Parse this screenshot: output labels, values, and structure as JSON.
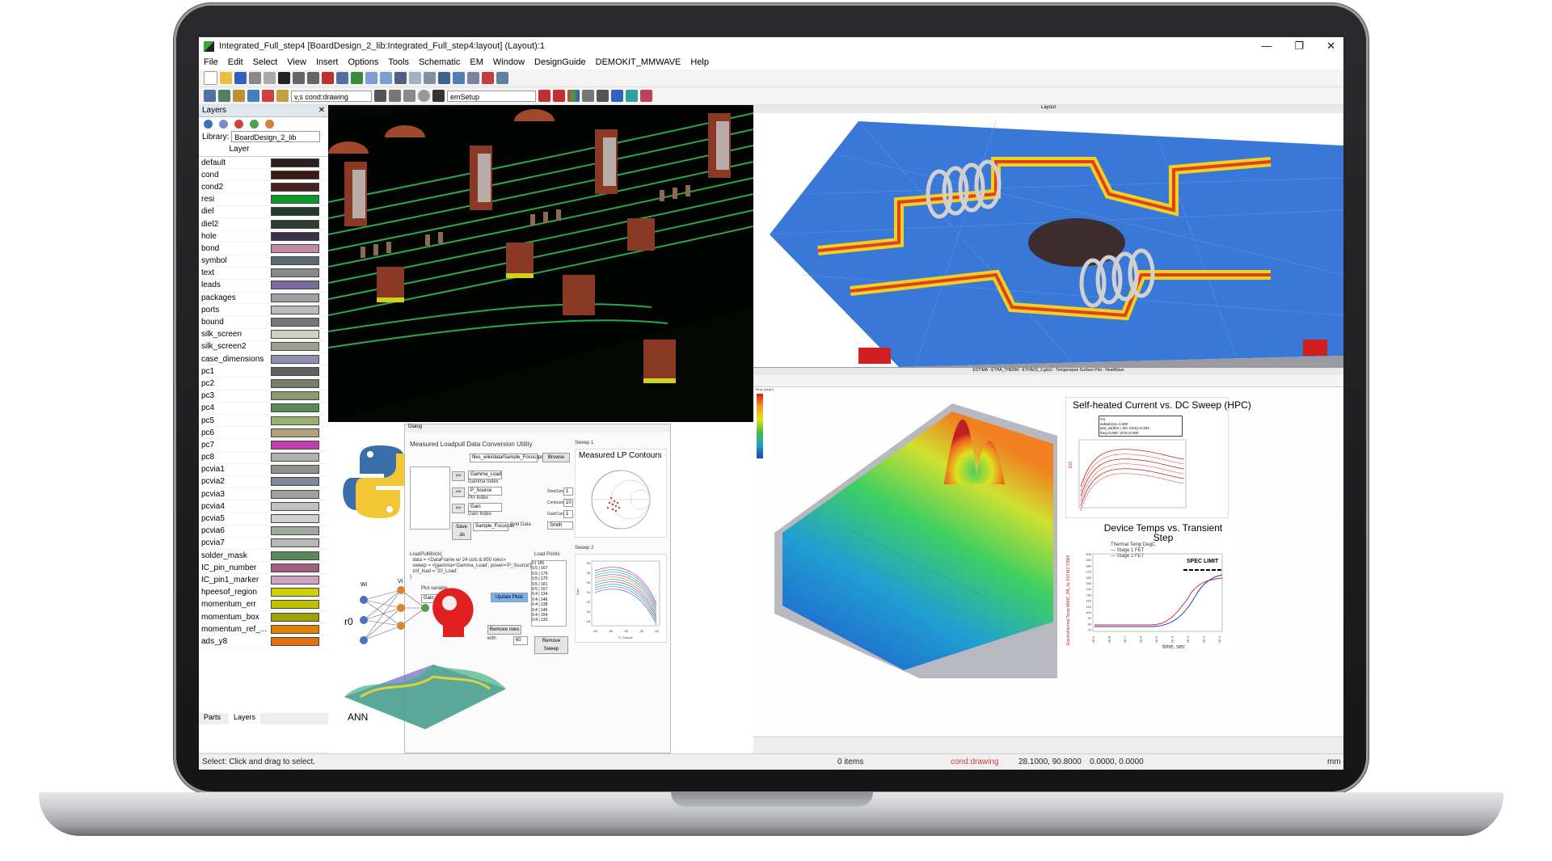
{
  "window": {
    "title": "Integrated_Full_step4 [BoardDesign_2_lib:Integrated_Full_step4:layout] (Layout):1",
    "controls": [
      "—",
      "❐",
      "✕"
    ]
  },
  "menu": [
    "File",
    "Edit",
    "Select",
    "View",
    "Insert",
    "Options",
    "Tools",
    "Schematic",
    "EM",
    "Window",
    "DesignGuide",
    "DEMOKIT_MMWAVE",
    "Help"
  ],
  "toolbar": {
    "layer_select": "v,s cond:drawing",
    "setup_select": "emSetup"
  },
  "layers_panel": {
    "title": "Layers",
    "library_label": "Library:",
    "library_value": "BoardDesign_2_lib",
    "column_header": "Layer",
    "tabs": [
      "Parts",
      "Layers"
    ],
    "items": [
      {
        "name": "default",
        "color": "#2a2020"
      },
      {
        "name": "cond",
        "color": "#3a1a12"
      },
      {
        "name": "cond2",
        "color": "#4a1f1f"
      },
      {
        "name": "resi",
        "color": "#0a9a2a"
      },
      {
        "name": "diel",
        "color": "#1f3a2a"
      },
      {
        "name": "diel2",
        "color": "#2a3d30"
      },
      {
        "name": "hole",
        "color": "#3a2f48"
      },
      {
        "name": "bond",
        "color": "#c08aa0"
      },
      {
        "name": "symbol",
        "color": "#5a6a70"
      },
      {
        "name": "text",
        "color": "#8a8a8a"
      },
      {
        "name": "leads",
        "color": "#7a6a9a"
      },
      {
        "name": "packages",
        "color": "#a0a0a0"
      },
      {
        "name": "ports",
        "color": "#bcbcbc"
      },
      {
        "name": "bound",
        "color": "#777777"
      },
      {
        "name": "silk_screen",
        "color": "#d0d0c0"
      },
      {
        "name": "silk_screen2",
        "color": "#a0a090"
      },
      {
        "name": "case_dimensions",
        "color": "#9090b0"
      },
      {
        "name": "pc1",
        "color": "#606060"
      },
      {
        "name": "pc2",
        "color": "#7a7a6a"
      },
      {
        "name": "pc3",
        "color": "#8a9a6a"
      },
      {
        "name": "pc4",
        "color": "#5a8a5a"
      },
      {
        "name": "pc5",
        "color": "#9ab070"
      },
      {
        "name": "pc6",
        "color": "#b0a080"
      },
      {
        "name": "pc7",
        "color": "#c040b0"
      },
      {
        "name": "pc8",
        "color": "#b0b0b0"
      },
      {
        "name": "pcvia1",
        "color": "#909090"
      },
      {
        "name": "pcvia2",
        "color": "#7a8a9a"
      },
      {
        "name": "pcvia3",
        "color": "#a0a0a0"
      },
      {
        "name": "pcvia4",
        "color": "#c0c0c0"
      },
      {
        "name": "pcvia5",
        "color": "#d0d0d0"
      },
      {
        "name": "pcvia6",
        "color": "#a0a8a0"
      },
      {
        "name": "pcvia7",
        "color": "#b8b8b8"
      },
      {
        "name": "solder_mask",
        "color": "#5a8a5a"
      },
      {
        "name": "IC_pin_number",
        "color": "#a06080"
      },
      {
        "name": "IC_pin1_marker",
        "color": "#d0a0c0"
      },
      {
        "name": "hpeesof_region",
        "color": "#d0d000"
      },
      {
        "name": "momentum_err",
        "color": "#c0c000"
      },
      {
        "name": "momentum_box",
        "color": "#a0a000"
      },
      {
        "name": "momentum_ref_...",
        "color": "#e08000"
      },
      {
        "name": "ads_y8",
        "color": "#e07010"
      }
    ]
  },
  "status": {
    "hint": "Select: Click and drag to select.",
    "items": "0 items",
    "layer": "cond:drawing",
    "coords1": "28.1000, 90.8000",
    "coords2": "0.0000, 0.0000",
    "units": "mm"
  },
  "dialog": {
    "title": "Dialog",
    "heading": "Measured Loadpull Data Conversion Utility",
    "browse": "Browse",
    "path": "files_wiki/data/Sample_Focus.lpc",
    "list": [
      "Gamma_Load",
      "Gamma Index",
      "P_Source",
      "Pin Index",
      "Gain",
      "Gain Index"
    ],
    "buttons": {
      "arrow": ">>",
      "save": "Save .ds",
      "update": "Update Plots",
      "remove_rows": "Remove rows",
      "remove_sweep": "Remove Sweep"
    },
    "save_file": "Sample_Focus.ds",
    "grid_data": "Grid Data",
    "sweep1": "Sweep 1",
    "sweep2": "Sweep 2",
    "params": [
      "StepSize",
      "Contours",
      "GainComp"
    ],
    "param_values": [
      "1",
      "10",
      "1"
    ],
    "smith": "Smith",
    "contours_title": "Measured LP Contours",
    "code_lines": [
      "LoadPullBlock(",
      "  data = <DataFrame w/ 24 cols & 850 rows>",
      "  sweep = <[gamma='Gamma_Load', power='P_Source']>",
      "  znf_load = '20_Load'",
      ")"
    ],
    "plot_variable": "Plot variable",
    "plot_value": "Gain",
    "load_points_title": "Load Points",
    "load_points": [
      "0 | 155",
      "0.5 | 167",
      "0.5 | 179",
      "0.5 | 170",
      "0.5 | 161",
      "0.5 | 157",
      "0.4 | 134",
      "0.4 | 146",
      "0.4 | 138",
      "0.4 | 146",
      "0.4 | 154",
      "0.4 | 132"
    ],
    "ann_label": "ANN",
    "r0_label": "r0",
    "wi_label": "Wi",
    "vi_label": "Vi",
    "sweep2_xaxis": "P_Source",
    "sweep2_yaxis": "Gain",
    "sweep2_xticks": [
      "-40",
      "-35",
      "-30",
      "-25",
      "-20"
    ],
    "sweep2_yticks": [
      "30",
      "28",
      "26",
      "24",
      "22",
      "20",
      "18"
    ],
    "with_label": "with",
    "sweep_value": "60"
  },
  "thermal": {
    "title_bar": "ESTIMA - ETHA_THERM - ETHA0S_3.gdx2 - Temperature Surface Plot - HeatWave",
    "chart1_title": "Self-heated Current vs. DC Sweep (HPC)",
    "chart1_ylabel": "IDS",
    "chart1_legend": [
      "m1",
      "indep(m1)=1.500",
      "plot_vs(IDS.i, DC.VGS)=0.333",
      "freq=0.000, VGS=0.000"
    ],
    "chart2_title": "Device Temps vs. Transient Step",
    "chart2_legend_title": "Thermal Temp DegC",
    "chart2_series": [
      "Stage 1 FET",
      "Stage 2 FET"
    ],
    "chart2_spec": "SPEC LIMIT",
    "chart2_xlabel": "time, sec",
    "chart2_ylabel": "Electrothermal Temp MMIC_PA_4x X10 M2 TOM3",
    "chart2_yticks": [
      "200",
      "190",
      "180",
      "170",
      "160",
      "150",
      "140",
      "130",
      "120",
      "110",
      "100",
      "90",
      "80",
      "70"
    ],
    "chart2_xticks": [
      "1E-9",
      "1E-8",
      "1E-7",
      "1E-6",
      "1E-5",
      "1E-4",
      "1E-3",
      "1E-2",
      "1E-1"
    ],
    "colorbar_label": "Temp (degC)"
  },
  "em": {
    "title": "Layout"
  }
}
